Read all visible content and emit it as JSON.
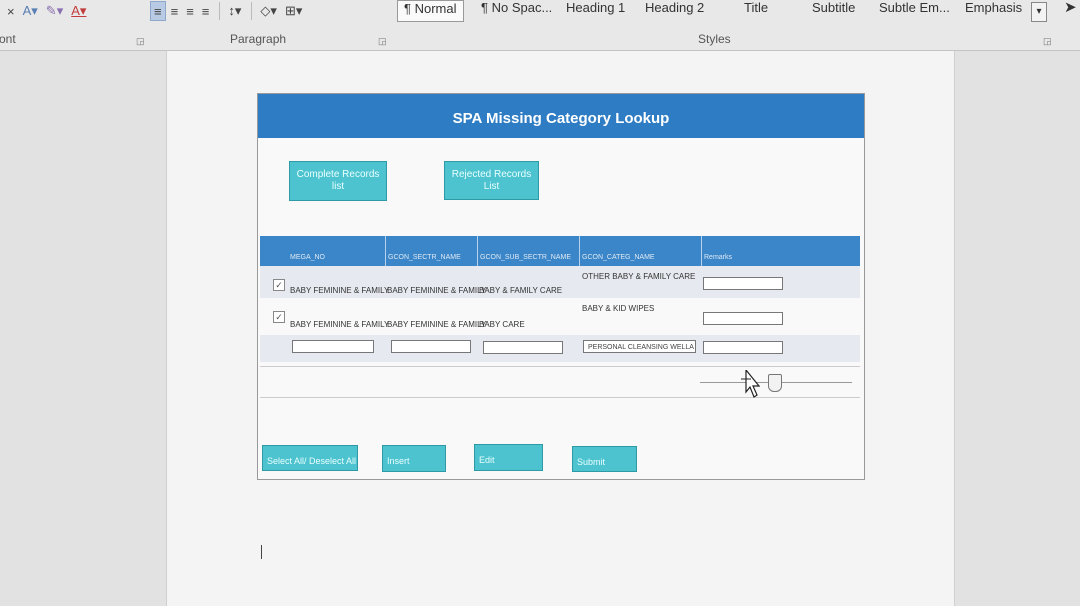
{
  "ribbon": {
    "groups": {
      "font_partial": "ont",
      "paragraph": "Paragraph",
      "styles": "Styles"
    },
    "styles": [
      "¶ Normal",
      "¶ No Spac...",
      "Heading 1",
      "Heading 2",
      "Title",
      "Subtitle",
      "Subtle Em...",
      "Emphasis"
    ]
  },
  "form": {
    "title": "SPA Missing Category Lookup",
    "buttons": {
      "complete": "Complete Records list",
      "rejected": "Rejected Records List"
    },
    "columns": [
      "MEGA_NO",
      "GCON_SECTR_NAME",
      "GCON_SUB_SECTR_NAME",
      "GCON_CATEG_NAME",
      "Remarks"
    ],
    "rows": [
      {
        "checked": "✓",
        "mega": "BABY FEMININE & FAMILY",
        "sectr": "BABY FEMININE & FAMILY",
        "sub": "BABY & FAMILY CARE",
        "categ": "OTHER BABY & FAMILY CARE"
      },
      {
        "checked": "✓",
        "mega": "BABY FEMININE & FAMILY",
        "sectr": "BABY FEMININE & FAMILY",
        "sub": "BABY CARE",
        "categ": "BABY & KID WIPES"
      }
    ],
    "new_row": {
      "categ_value": "PERSONAL CLEANSING WELLA"
    },
    "footer_buttons": {
      "select_all": "Select All/ Deselect All",
      "insert": "Insert",
      "edit": "Edit",
      "submit": "Submit"
    }
  },
  "colors": {
    "header_blue": "#2e7cc4",
    "grid_blue": "#3a86c8",
    "button_teal": "#4cc3cf"
  }
}
